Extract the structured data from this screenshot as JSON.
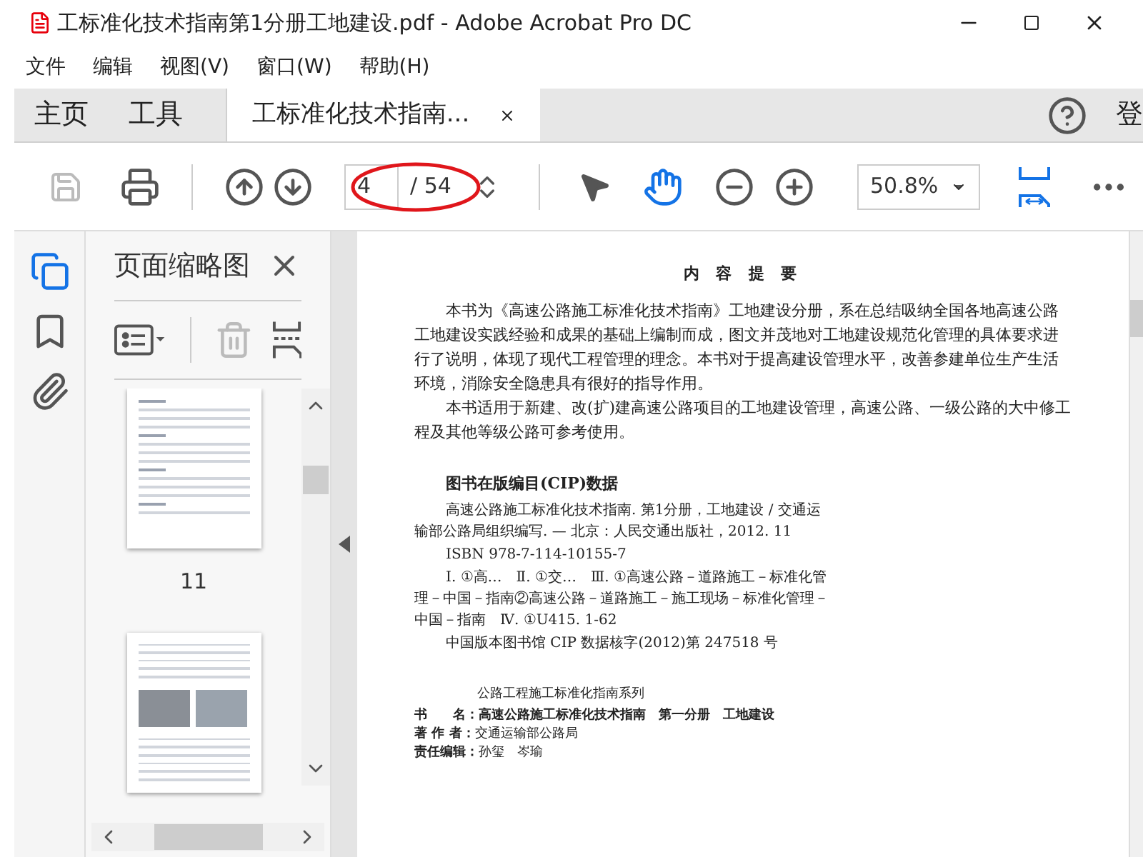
{
  "window": {
    "title": "工标准化技术指南第1分册工地建设.pdf - Adobe Acrobat Pro DC"
  },
  "menu": [
    "文件",
    "编辑",
    "视图(V)",
    "窗口(W)",
    "帮助(H)"
  ],
  "tabs": [
    {
      "label": "主页",
      "selected": false,
      "kind": "nav"
    },
    {
      "label": "工具",
      "selected": false,
      "kind": "nav"
    },
    {
      "label": "工标准化技术指南...",
      "selected": true,
      "kind": "document"
    }
  ],
  "account_label": "登",
  "toolbar": {
    "page_value": "4",
    "page_total": "/ 54",
    "zoom": "50.8%"
  },
  "sidebar": {
    "title": "页面缩略图",
    "thumbnails": [
      {
        "label": "11",
        "kind": "text"
      },
      {
        "kind": "photos"
      }
    ]
  },
  "document": {
    "heading": "内 容 提 要",
    "paragraphs": [
      "本书为《高速公路施工标准化技术指南》工地建设分册，系在总结吸纳全国各地高速公路工地建设实践经验和成果的基础上编制而成，图文并茂地对工地建设规范化管理的具体要求进行了说明，体现了现代工程管理的理念。本书对于提高建设管理水平，改善参建单位生产生活环境，消除安全隐患具有很好的指导作用。",
      "本书适用于新建、改(扩)建高速公路项目的工地建设管理，高速公路、一级公路的大中修工程及其他等级公路可参考使用。"
    ],
    "cip_title": "图书在版编目(CIP)数据",
    "cip_entries": [
      "高速公路施工标准化技术指南. 第1分册，工地建设 / 交通运输部公路局组织编写. — 北京：人民交通出版社，2012. 11",
      "ISBN 978-7-114-10155-7",
      "Ⅰ. ①高…　Ⅱ. ①交…　Ⅲ. ①高速公路－道路施工－标准化管理－中国－指南②高速公路－道路施工－施工现场－标准化管理－中国－指南　Ⅳ. ①U415. 1-62",
      "中国版本图书馆 CIP 数据核字(2012)第 247518 号"
    ],
    "series": "公路工程施工标准化指南系列",
    "credits": [
      {
        "label": "书　　名：",
        "value": "高速公路施工标准化技术指南　第一分册　工地建设",
        "kind": "title"
      },
      {
        "label": "著 作 者：",
        "value": "交通运输部公路局",
        "kind": "plain"
      },
      {
        "label": "责任编辑：",
        "value": "孙玺　岑瑜",
        "kind": "plain"
      }
    ]
  }
}
